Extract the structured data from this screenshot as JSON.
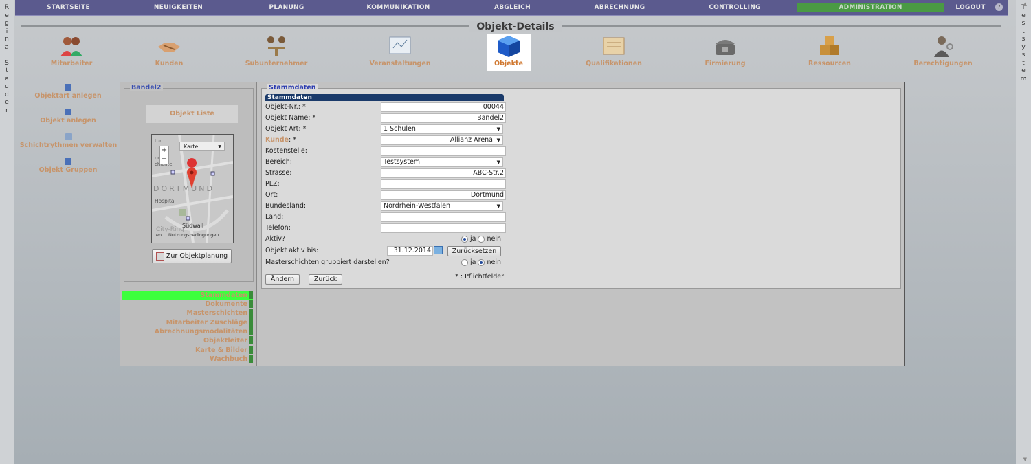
{
  "left_sidebar_user": "Regina Stauder",
  "right_sidebar_system": "Testsystem",
  "nav": [
    "STARTSEITE",
    "NEUIGKEITEN",
    "PLANUNG",
    "KOMMUNIKATION",
    "ABGLEICH",
    "ABRECHNUNG",
    "CONTROLLING",
    "ADMINISTRATION",
    "LOGOUT"
  ],
  "page_title": "Objekt-Details",
  "modules": [
    "Mitarbeiter",
    "Kunden",
    "Subunternehmer",
    "Veranstaltungen",
    "Objekte",
    "Qualifikationen",
    "Firmierung",
    "Ressourcen",
    "Berechtigungen"
  ],
  "left_links": [
    "Objektart anlegen",
    "Objekt anlegen",
    "Schichtrythmen verwalten",
    "Objekt Gruppen"
  ],
  "object_panel": {
    "legend": "Bandel2",
    "list_button": "Objekt Liste",
    "map": {
      "type_label": "Karte",
      "plus": "+",
      "minus": "−",
      "city": "DORTMUND",
      "hospital": "Hospital",
      "place1": "Südwall",
      "place2": "City-Ring",
      "fragment1": "tur",
      "fragment2": "nd",
      "fragment3": "chichte",
      "map_footer_left": "en",
      "map_footer": "Nutzungsbedingungen"
    },
    "plan_button": "Zur Objektplanung"
  },
  "tabs": [
    "Stammdaten",
    "Dokumente",
    "Masterschichten",
    "Mitarbeiter Zuschläge",
    "Abrechnungsmodalitäten",
    "Objektleiter",
    "Karte & Bilder",
    "Wachbuch"
  ],
  "form": {
    "legend": "Stammdaten",
    "header": "Stammdaten",
    "objekt_nr_label": "Objekt-Nr.: *",
    "objekt_nr": "00044",
    "objekt_name_label": "Objekt Name: *",
    "objekt_name": "Bandel2",
    "objekt_art_label": "Objekt Art: *",
    "objekt_art": "1 Schulen",
    "kunde_label": "Kunde",
    "kunde_suffix": ": *",
    "kunde": "Allianz Arena",
    "kostenstelle_label": "Kostenstelle:",
    "kostenstelle": "",
    "bereich_label": "Bereich:",
    "bereich": "Testsystem",
    "strasse_label": "Strasse:",
    "strasse": "ABC-Str.2",
    "plz_label": "PLZ:",
    "plz": "",
    "ort_label": "Ort:",
    "ort": "Dortmund",
    "bundesland_label": "Bundesland:",
    "bundesland": "Nordrhein-Westfalen",
    "land_label": "Land:",
    "land": "",
    "telefon_label": "Telefon:",
    "telefon": "",
    "aktiv_label": "Aktiv?",
    "ja": "ja",
    "nein": "nein",
    "aktiv_bis_label": "Objekt aktiv bis:",
    "aktiv_bis": "31.12.2014",
    "reset": "Zurücksetzen",
    "master_label": "Masterschichten gruppiert darstellen?",
    "aendern": "Ändern",
    "zurueck": "Zurück",
    "pflicht": "* : Pflichtfelder"
  }
}
